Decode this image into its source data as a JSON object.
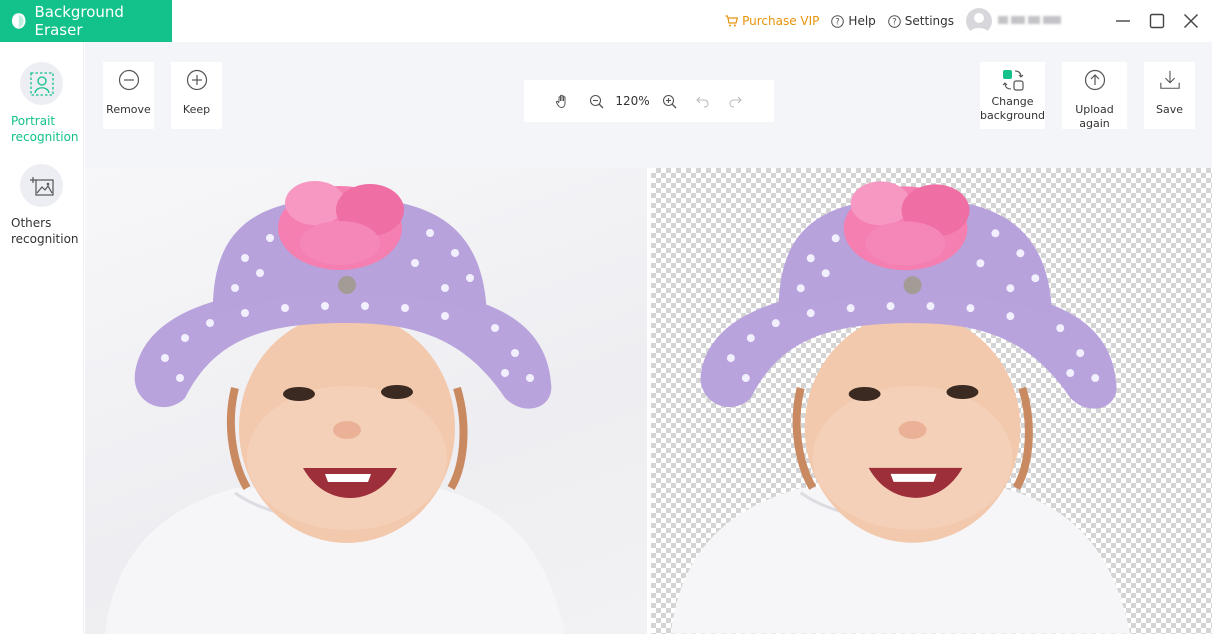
{
  "app": {
    "title": "Background Eraser",
    "brand_color": "#13c18b",
    "accent_orange": "#e8930c"
  },
  "header": {
    "purchase_vip": "Purchase VIP",
    "help": "Help",
    "settings": "Settings",
    "window_controls": [
      "minimize-icon",
      "maximize-icon",
      "close-icon"
    ]
  },
  "sidebar": {
    "items": [
      {
        "label": "Portrait\nrecognition",
        "icon": "portrait-icon",
        "active": true
      },
      {
        "label": "Others\nrecognition",
        "icon": "image-sparkle-icon",
        "active": false
      }
    ]
  },
  "toolbar": {
    "remove_label": "Remove",
    "keep_label": "Keep",
    "zoom_level": "120%",
    "change_background_label": "Change\nbackground",
    "upload_again_label": "Upload again",
    "save_label": "Save"
  },
  "canvas": {
    "left_panel": "original-image",
    "right_panel": "transparent-background-result"
  }
}
